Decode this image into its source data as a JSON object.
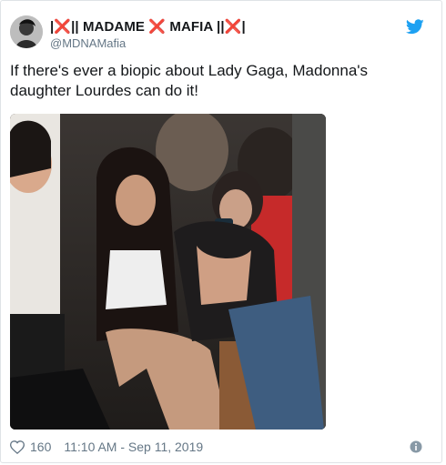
{
  "tweet": {
    "display_name_parts": [
      "|",
      "❌",
      "|| MADAME ",
      "❌",
      " MAFIA ||",
      "❌",
      "|"
    ],
    "handle": "@MDNAMafia",
    "text": "If there's ever a biopic about Lady Gaga, Madonna's daughter Lourdes can do it!",
    "likes": "160",
    "timestamp": "11:10 AM - Sep 11, 2019"
  },
  "icons": {
    "brand": "twitter-bird-icon",
    "like": "heart-outline-icon",
    "info": "info-circle-icon"
  },
  "colors": {
    "accent": "#1da1f2",
    "name_x": "#d0202a",
    "secondary_text": "#657786"
  }
}
